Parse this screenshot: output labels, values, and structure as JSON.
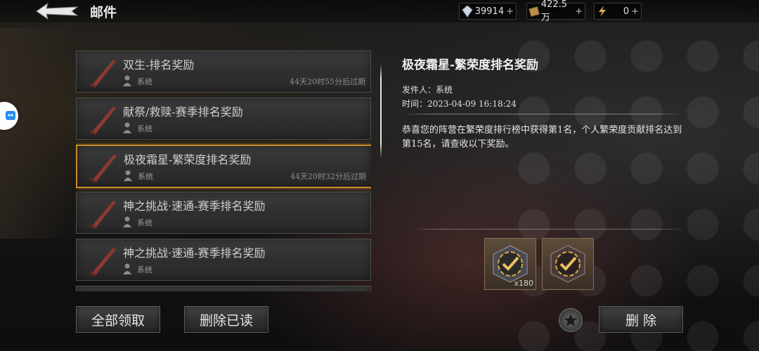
{
  "header": {
    "title": "邮件",
    "back_icon": "back-arrow-icon"
  },
  "resources": [
    {
      "name": "crystal",
      "icon": "crystal-icon",
      "value": "39914",
      "plus": "+"
    },
    {
      "name": "gold",
      "icon": "gold-icon",
      "value": "422.5万",
      "plus": "+"
    },
    {
      "name": "energy",
      "icon": "lightning-icon",
      "value": "0",
      "plus": "+"
    }
  ],
  "mails": [
    {
      "subject": "双生-排名奖励",
      "sender": "系统",
      "expiry": "44天20时55分后过期",
      "selected": false
    },
    {
      "subject": "献祭/救赎-赛季排名奖励",
      "sender": "系统",
      "expiry": "",
      "selected": false
    },
    {
      "subject": "极夜霜星-繁荣度排名奖励",
      "sender": "系统",
      "expiry": "44天20时32分后过期",
      "selected": true
    },
    {
      "subject": "神之挑战·速通-赛季排名奖励",
      "sender": "系统",
      "expiry": "",
      "selected": false
    },
    {
      "subject": "神之挑战·速通-赛季排名奖励",
      "sender": "系统",
      "expiry": "",
      "selected": false
    }
  ],
  "detail": {
    "title": "极夜霜星-繁荣度排名奖励",
    "sender_label": "发件人：",
    "sender": "系统",
    "time_label": "时间：",
    "time": "2023-04-09 16:18:24",
    "body": "恭喜您的阵营在繁荣度排行榜中获得第1名，个人繁荣度贡献排名达到第15名，请查收以下奖励。",
    "rewards": [
      {
        "icon": "reward-check-icon",
        "qty": "x180"
      },
      {
        "icon": "reward-check-icon",
        "qty": ""
      }
    ]
  },
  "buttons": {
    "claim_all": "全部领取",
    "delete_read": "删除已读",
    "delete": "删 除",
    "star_icon": "star-icon"
  },
  "colors": {
    "selected_border": "#c98a2a",
    "panel_bg": "#333333"
  }
}
